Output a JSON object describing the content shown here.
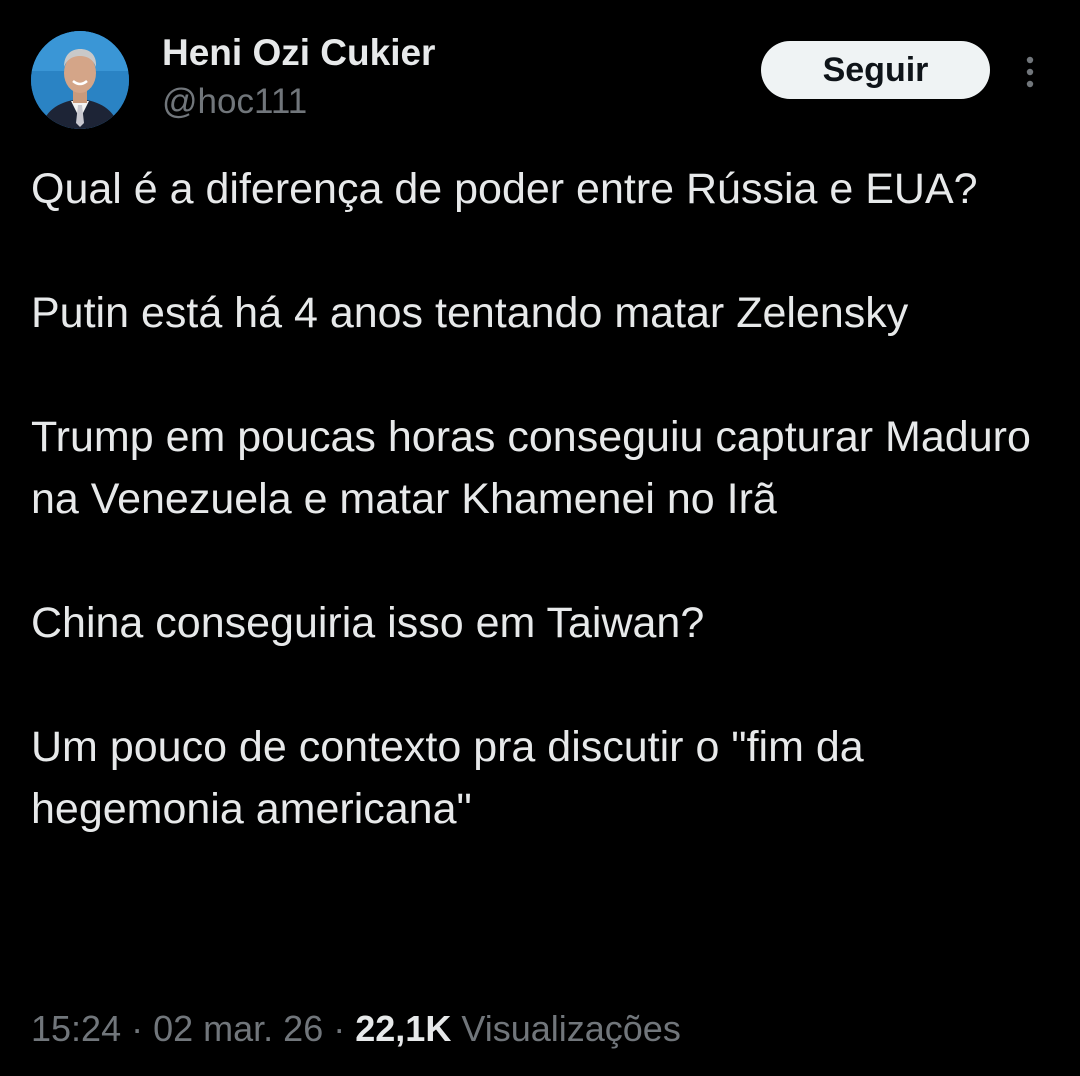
{
  "author": {
    "name": "Heni Ozi Cukier",
    "handle": "@hoc111"
  },
  "follow_button": {
    "label": "Seguir"
  },
  "more_icon": "more-vertical-icon",
  "tweet": {
    "paragraphs": [
      "Qual é a diferença de poder entre Rússia e EUA?",
      "Putin está há 4 anos tentando matar Zelensky",
      "Trump em poucas horas conseguiu capturar Maduro na Venezuela e matar Khamenei no Irã",
      "China conseguiria isso em Taiwan?",
      "Um pouco de contexto pra discutir o \"fim da hegemonia americana\""
    ]
  },
  "meta": {
    "time": "15:24",
    "separator": "·",
    "date": "02 mar. 26",
    "views_count": "22,1K",
    "views_label": "Visualizações"
  },
  "colors": {
    "background": "#000000",
    "text_primary": "#e7e9ea",
    "text_secondary": "#71767b",
    "button_bg": "#eff3f4",
    "button_text": "#0f1419"
  }
}
